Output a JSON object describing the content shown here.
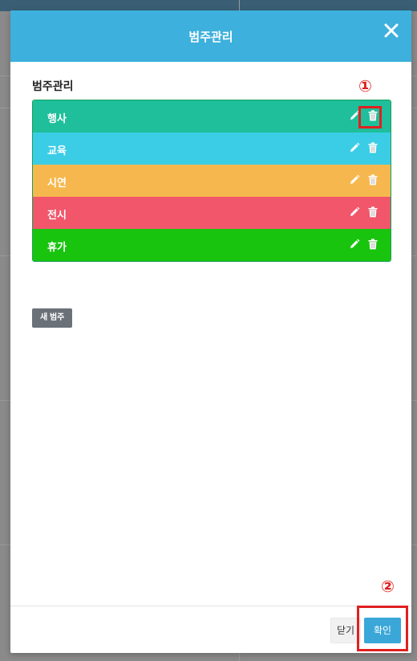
{
  "modal": {
    "title": "범주관리",
    "section_title": "범주관리",
    "categories": [
      {
        "name": "행사",
        "color": "#1ebf9a"
      },
      {
        "name": "교육",
        "color": "#3bcde6"
      },
      {
        "name": "시연",
        "color": "#f6b84e"
      },
      {
        "name": "전시",
        "color": "#f1566b"
      },
      {
        "name": "휴가",
        "color": "#19c40e"
      }
    ],
    "new_category_label": "새 범주",
    "close_label": "닫기",
    "confirm_label": "확인"
  },
  "annotations": {
    "marker1": "①",
    "marker2": "②"
  },
  "colors": {
    "header": "#3db0dd",
    "highlight": "#e02020",
    "confirm_button": "#3aa7d8"
  }
}
